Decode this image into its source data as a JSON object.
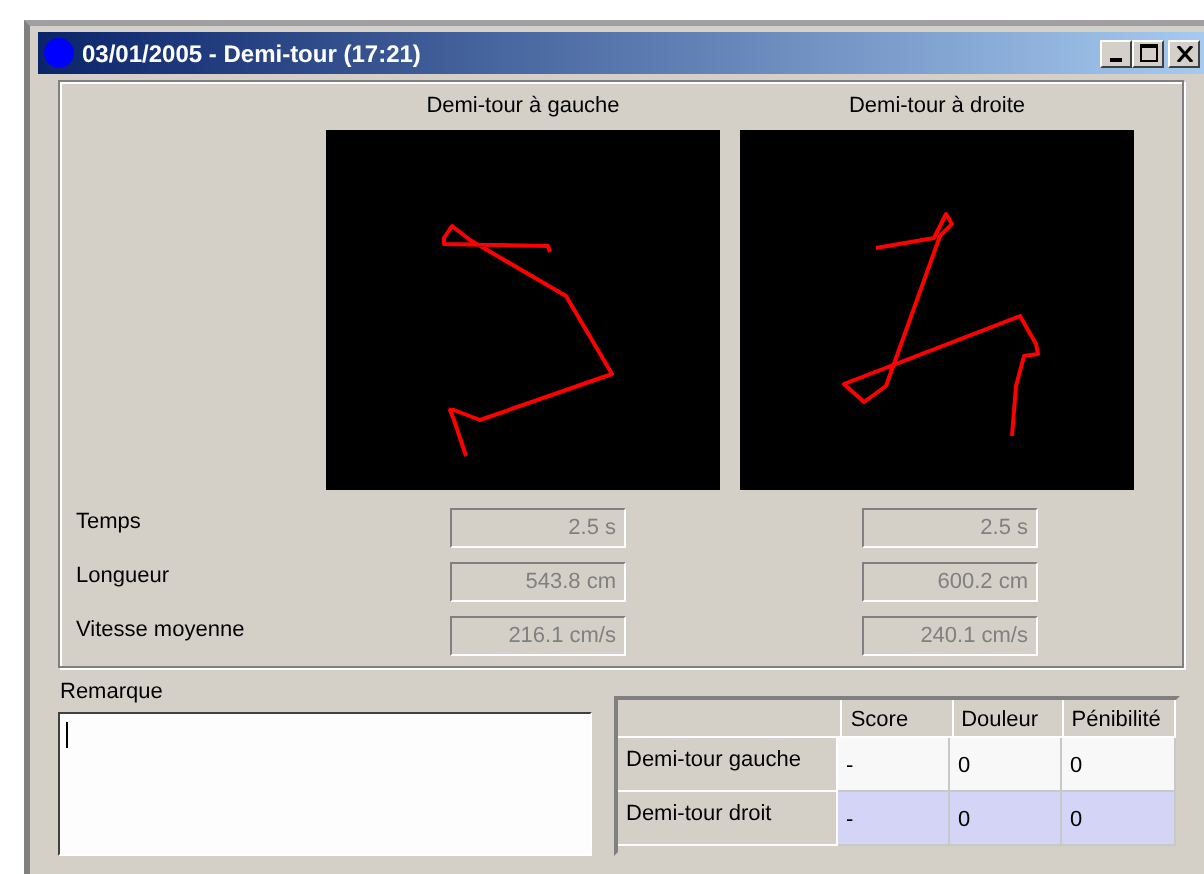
{
  "window": {
    "title": "03/01/2005 - Demi-tour (17:21)"
  },
  "plots": [
    {
      "title": "Demi-tour à gauche"
    },
    {
      "title": "Demi-tour à droite"
    }
  ],
  "measures": [
    {
      "label": "Temps",
      "values": [
        "2.5 s",
        "2.5 s"
      ]
    },
    {
      "label": "Longueur",
      "values": [
        "543.8 cm",
        "600.2 cm"
      ]
    },
    {
      "label": "Vitesse moyenne",
      "values": [
        "216.1 cm/s",
        "240.1 cm/s"
      ]
    }
  ],
  "remark": {
    "label": "Remarque"
  },
  "table": {
    "columns": [
      "Score",
      "Douleur",
      "Pénibilité"
    ],
    "rows": [
      {
        "label": "Demi-tour gauche",
        "cells": [
          "-",
          "0",
          "0"
        ],
        "selected": false
      },
      {
        "label": "Demi-tour droit",
        "cells": [
          "-",
          "0",
          "0"
        ],
        "selected": true
      }
    ]
  }
}
